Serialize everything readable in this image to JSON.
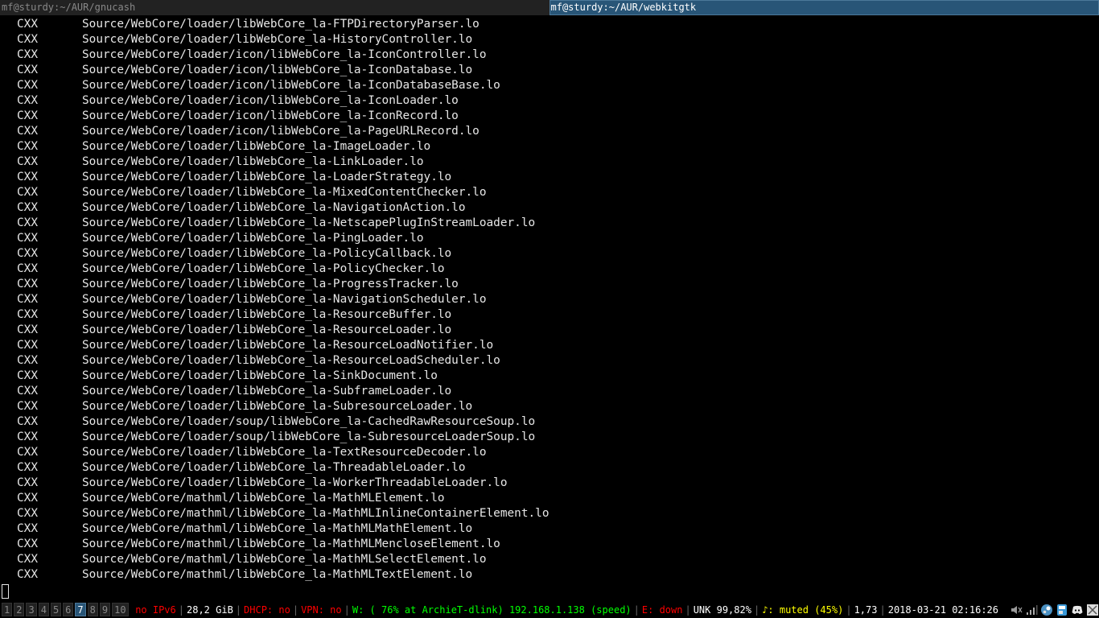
{
  "tabs": [
    {
      "label": "mf@sturdy:~/AUR/gnucash",
      "active": false
    },
    {
      "label": "mf@sturdy:~/AUR/webkitgtk",
      "active": true
    }
  ],
  "terminal": {
    "lines": [
      [
        "CXX",
        "Source/WebCore/loader/libWebCore_la-FTPDirectoryParser.lo"
      ],
      [
        "CXX",
        "Source/WebCore/loader/libWebCore_la-HistoryController.lo"
      ],
      [
        "CXX",
        "Source/WebCore/loader/icon/libWebCore_la-IconController.lo"
      ],
      [
        "CXX",
        "Source/WebCore/loader/icon/libWebCore_la-IconDatabase.lo"
      ],
      [
        "CXX",
        "Source/WebCore/loader/icon/libWebCore_la-IconDatabaseBase.lo"
      ],
      [
        "CXX",
        "Source/WebCore/loader/icon/libWebCore_la-IconLoader.lo"
      ],
      [
        "CXX",
        "Source/WebCore/loader/icon/libWebCore_la-IconRecord.lo"
      ],
      [
        "CXX",
        "Source/WebCore/loader/icon/libWebCore_la-PageURLRecord.lo"
      ],
      [
        "CXX",
        "Source/WebCore/loader/libWebCore_la-ImageLoader.lo"
      ],
      [
        "CXX",
        "Source/WebCore/loader/libWebCore_la-LinkLoader.lo"
      ],
      [
        "CXX",
        "Source/WebCore/loader/libWebCore_la-LoaderStrategy.lo"
      ],
      [
        "CXX",
        "Source/WebCore/loader/libWebCore_la-MixedContentChecker.lo"
      ],
      [
        "CXX",
        "Source/WebCore/loader/libWebCore_la-NavigationAction.lo"
      ],
      [
        "CXX",
        "Source/WebCore/loader/libWebCore_la-NetscapePlugInStreamLoader.lo"
      ],
      [
        "CXX",
        "Source/WebCore/loader/libWebCore_la-PingLoader.lo"
      ],
      [
        "CXX",
        "Source/WebCore/loader/libWebCore_la-PolicyCallback.lo"
      ],
      [
        "CXX",
        "Source/WebCore/loader/libWebCore_la-PolicyChecker.lo"
      ],
      [
        "CXX",
        "Source/WebCore/loader/libWebCore_la-ProgressTracker.lo"
      ],
      [
        "CXX",
        "Source/WebCore/loader/libWebCore_la-NavigationScheduler.lo"
      ],
      [
        "CXX",
        "Source/WebCore/loader/libWebCore_la-ResourceBuffer.lo"
      ],
      [
        "CXX",
        "Source/WebCore/loader/libWebCore_la-ResourceLoader.lo"
      ],
      [
        "CXX",
        "Source/WebCore/loader/libWebCore_la-ResourceLoadNotifier.lo"
      ],
      [
        "CXX",
        "Source/WebCore/loader/libWebCore_la-ResourceLoadScheduler.lo"
      ],
      [
        "CXX",
        "Source/WebCore/loader/libWebCore_la-SinkDocument.lo"
      ],
      [
        "CXX",
        "Source/WebCore/loader/libWebCore_la-SubframeLoader.lo"
      ],
      [
        "CXX",
        "Source/WebCore/loader/libWebCore_la-SubresourceLoader.lo"
      ],
      [
        "CXX",
        "Source/WebCore/loader/soup/libWebCore_la-CachedRawResourceSoup.lo"
      ],
      [
        "CXX",
        "Source/WebCore/loader/soup/libWebCore_la-SubresourceLoaderSoup.lo"
      ],
      [
        "CXX",
        "Source/WebCore/loader/libWebCore_la-TextResourceDecoder.lo"
      ],
      [
        "CXX",
        "Source/WebCore/loader/libWebCore_la-ThreadableLoader.lo"
      ],
      [
        "CXX",
        "Source/WebCore/loader/libWebCore_la-WorkerThreadableLoader.lo"
      ],
      [
        "CXX",
        "Source/WebCore/mathml/libWebCore_la-MathMLElement.lo"
      ],
      [
        "CXX",
        "Source/WebCore/mathml/libWebCore_la-MathMLInlineContainerElement.lo"
      ],
      [
        "CXX",
        "Source/WebCore/mathml/libWebCore_la-MathMLMathElement.lo"
      ],
      [
        "CXX",
        "Source/WebCore/mathml/libWebCore_la-MathMLMencloseElement.lo"
      ],
      [
        "CXX",
        "Source/WebCore/mathml/libWebCore_la-MathMLSelectElement.lo"
      ],
      [
        "CXX",
        "Source/WebCore/mathml/libWebCore_la-MathMLTextElement.lo"
      ]
    ]
  },
  "workspaces": [
    {
      "label": "1",
      "focused": false
    },
    {
      "label": "2",
      "focused": false
    },
    {
      "label": "3",
      "focused": false
    },
    {
      "label": "4",
      "focused": false
    },
    {
      "label": "5",
      "focused": false
    },
    {
      "label": "6",
      "focused": false
    },
    {
      "label": "7",
      "focused": true
    },
    {
      "label": "8",
      "focused": false
    },
    {
      "label": "9",
      "focused": false
    },
    {
      "label": "10",
      "focused": false
    }
  ],
  "status": {
    "ipv6": "no IPv6",
    "disk": "28,2 GiB",
    "dhcp": "DHCP: no",
    "vpn": "VPN: no",
    "wifi": "W: ( 76% at ArchieT-dlink) 192.168.1.138 (speed)",
    "ethernet": "E: down",
    "battery": "UNK 99,82%",
    "volume": "♪: muted (45%)",
    "load": "1,73",
    "datetime": "2018-03-21 02:16:26"
  },
  "tray_icons": [
    "volume-icon",
    "network-signal-icon",
    "steam-icon",
    "app-icon",
    "discord-icon",
    "settings-icon"
  ],
  "colors": {
    "focused_bg": "#285577",
    "status_bad": "#ff0000",
    "status_good": "#00ff00",
    "status_warn": "#ffff00"
  }
}
